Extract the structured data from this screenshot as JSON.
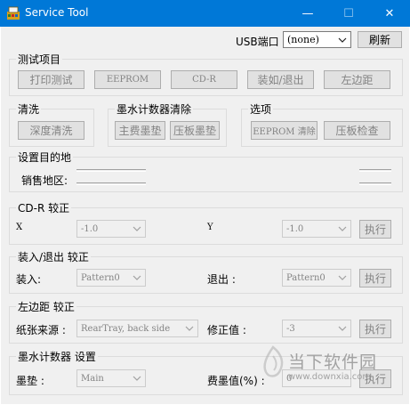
{
  "window": {
    "title": "Service Tool",
    "minimize_glyph": "—",
    "maximize_glyph": "☐",
    "close_glyph": "✕"
  },
  "header": {
    "usb_port_label": "USB端口",
    "usb_port_value": "(none)",
    "refresh_label": "刷新"
  },
  "test_group": {
    "title": "测试项目",
    "buttons": [
      "打印测试",
      "EEPROM",
      "CD-R",
      "装如/退出",
      "左边距"
    ]
  },
  "clean_group": {
    "title": "清洗",
    "deep_clean_label": "深度清洗"
  },
  "ink_counter_clear_group": {
    "title": "墨水计数器清除",
    "main_pad_label": "主费墨垫",
    "platen_pad_label": "压板墨垫"
  },
  "options_group": {
    "title": "选项",
    "eeprom_clear_label": "EEPROM 清除",
    "platen_check_label": "压板检查"
  },
  "destination_group": {
    "title": "设置目的地",
    "sales_region_label": "销售地区:"
  },
  "cdr_group": {
    "title": "CD-R 较正",
    "x_label": "X",
    "x_value": "-1.0",
    "y_label": "Y",
    "y_value": "-1.0",
    "execute_label": "执行"
  },
  "load_eject_group": {
    "title": "装入/退出 较正",
    "load_label": "装入:",
    "load_value": "Pattern0",
    "eject_label": "退出 :",
    "eject_value": "Pattern0",
    "execute_label": "执行"
  },
  "left_margin_group": {
    "title": "左边距 较正",
    "paper_source_label": "纸张来源 :",
    "paper_source_value": "RearTray, back side",
    "correction_label": "修正值 :",
    "correction_value": "-3",
    "execute_label": "执行"
  },
  "ink_counter_group": {
    "title": "墨水计数器 设置",
    "ink_pad_label": "墨垫 :",
    "ink_pad_value": "Main",
    "waste_ink_label": "费墨值(%) :",
    "waste_ink_value": "0",
    "execute_label": "执行"
  },
  "watermark": {
    "brand": "当下软件园",
    "url": "www.downxia.com"
  },
  "colors": {
    "titlebar": "#0078d7",
    "window_bg": "#f0f0f0",
    "disabled_text": "#838383"
  }
}
